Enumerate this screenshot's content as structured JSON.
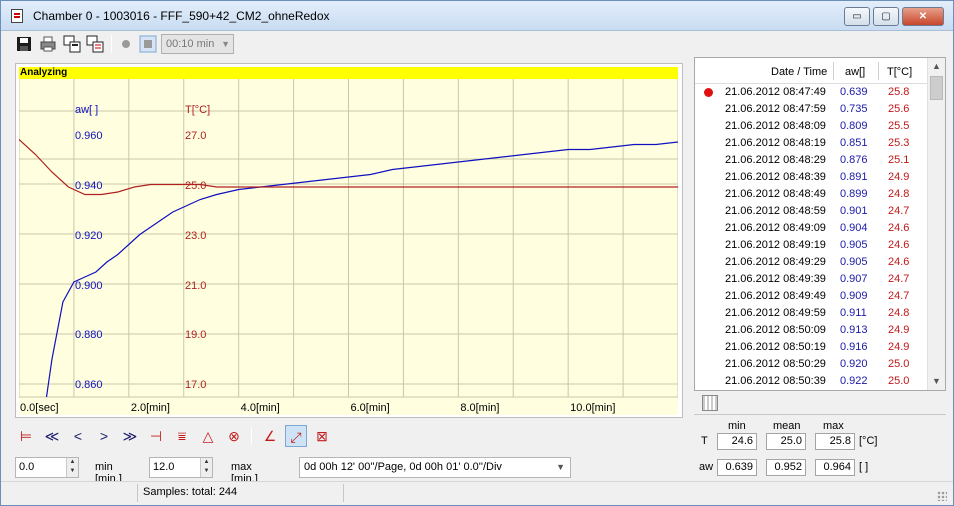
{
  "window": {
    "title": "Chamber 0 - 1003016 - FFF_590+42_CM2_ohneRedox",
    "minimize_glyph": "▭",
    "maximize_glyph": "▢",
    "close_glyph": "✕"
  },
  "toolbar": {
    "interval_value": "00:10 min",
    "icons": [
      "save-icon",
      "print-icon",
      "copy-window-icon",
      "copy-data-icon",
      "record-icon",
      "stop-icon"
    ]
  },
  "chart": {
    "status_label": "Analyzing",
    "status_color": "#ffff00",
    "background_color": "#ffffe0",
    "aw_color": "#1010c0",
    "t_color": "#b02020",
    "aw_axis_label": "aw[ ]",
    "t_axis_label": "T[°C]",
    "aw_ticks": [
      "0.960",
      "0.940",
      "0.920",
      "0.900",
      "0.880",
      "0.860"
    ],
    "t_ticks": [
      "27.0",
      "25.0",
      "23.0",
      "21.0",
      "19.0",
      "17.0"
    ],
    "x_ticks": [
      "0.0[sec]",
      "2.0[min]",
      "4.0[min]",
      "6.0[min]",
      "8.0[min]",
      "10.0[min]"
    ]
  },
  "chart_data": {
    "type": "line",
    "xlim": [
      0,
      12
    ],
    "x_unit": "min",
    "series": [
      {
        "name": "aw[ ]",
        "axis": "left",
        "ylim": [
          0.855,
          0.975
        ],
        "x": [
          0.5,
          0.6,
          0.8,
          1.0,
          1.2,
          1.4,
          1.6,
          1.8,
          2.0,
          2.2,
          2.4,
          2.6,
          2.8,
          3.0,
          3.3,
          3.6,
          4.0,
          4.4,
          4.8,
          5.2,
          5.6,
          6.0,
          6.4,
          6.8,
          7.2,
          7.6,
          8.0,
          8.4,
          8.8,
          9.2,
          9.6,
          10.0,
          10.4,
          10.8,
          11.2,
          11.6,
          12.0
        ],
        "y": [
          0.855,
          0.87,
          0.893,
          0.901,
          0.903,
          0.905,
          0.909,
          0.912,
          0.916,
          0.92,
          0.923,
          0.926,
          0.929,
          0.931,
          0.934,
          0.936,
          0.938,
          0.939,
          0.94,
          0.941,
          0.942,
          0.943,
          0.944,
          0.946,
          0.947,
          0.948,
          0.949,
          0.95,
          0.951,
          0.952,
          0.953,
          0.954,
          0.954,
          0.955,
          0.956,
          0.956,
          0.957
        ]
      },
      {
        "name": "T[°C]",
        "axis": "right",
        "ylim": [
          16.5,
          28.5
        ],
        "x": [
          0.0,
          0.3,
          0.6,
          0.9,
          1.2,
          1.5,
          1.8,
          2.1,
          2.4,
          2.7,
          3.0,
          3.3,
          3.6,
          3.9,
          4.2,
          4.8,
          6.0,
          8.0,
          10.0,
          12.0
        ],
        "y": [
          26.8,
          26.2,
          25.5,
          24.9,
          24.6,
          24.6,
          24.7,
          24.9,
          25.0,
          25.0,
          25.0,
          25.0,
          24.9,
          24.9,
          24.9,
          24.9,
          24.9,
          24.9,
          24.9,
          24.9
        ]
      }
    ]
  },
  "nav": {
    "icons": [
      "first-marker-icon",
      "rewind-icon",
      "previous-icon",
      "next-icon",
      "fast-forward-icon",
      "last-marker-icon",
      "range-icon",
      "baseline-icon",
      "analysis-icon",
      "curve-a-icon",
      "zoom-curve-icon",
      "fit-icon"
    ]
  },
  "range": {
    "min_value": "0.0",
    "min_label": "min [min.]",
    "max_value": "12.0",
    "max_label": "max [min.]",
    "page_setting": "0d 00h 12' 00''/Page, 0d 00h 01' 0.0''/Div"
  },
  "status": {
    "samples": "Samples: total: 244"
  },
  "table": {
    "headers": {
      "date": "Date / Time",
      "aw": "aw[]",
      "t": "T[°C]"
    },
    "rows": [
      {
        "date": "21.06.2012 08:47:49",
        "aw": "0.639",
        "t": "25.8",
        "marker": true
      },
      {
        "date": "21.06.2012 08:47:59",
        "aw": "0.735",
        "t": "25.6"
      },
      {
        "date": "21.06.2012 08:48:09",
        "aw": "0.809",
        "t": "25.5"
      },
      {
        "date": "21.06.2012 08:48:19",
        "aw": "0.851",
        "t": "25.3"
      },
      {
        "date": "21.06.2012 08:48:29",
        "aw": "0.876",
        "t": "25.1"
      },
      {
        "date": "21.06.2012 08:48:39",
        "aw": "0.891",
        "t": "24.9"
      },
      {
        "date": "21.06.2012 08:48:49",
        "aw": "0.899",
        "t": "24.8"
      },
      {
        "date": "21.06.2012 08:48:59",
        "aw": "0.901",
        "t": "24.7"
      },
      {
        "date": "21.06.2012 08:49:09",
        "aw": "0.904",
        "t": "24.6"
      },
      {
        "date": "21.06.2012 08:49:19",
        "aw": "0.905",
        "t": "24.6"
      },
      {
        "date": "21.06.2012 08:49:29",
        "aw": "0.905",
        "t": "24.6"
      },
      {
        "date": "21.06.2012 08:49:39",
        "aw": "0.907",
        "t": "24.7"
      },
      {
        "date": "21.06.2012 08:49:49",
        "aw": "0.909",
        "t": "24.7"
      },
      {
        "date": "21.06.2012 08:49:59",
        "aw": "0.911",
        "t": "24.8"
      },
      {
        "date": "21.06.2012 08:50:09",
        "aw": "0.913",
        "t": "24.9"
      },
      {
        "date": "21.06.2012 08:50:19",
        "aw": "0.916",
        "t": "24.9"
      },
      {
        "date": "21.06.2012 08:50:29",
        "aw": "0.920",
        "t": "25.0"
      },
      {
        "date": "21.06.2012 08:50:39",
        "aw": "0.922",
        "t": "25.0"
      }
    ]
  },
  "stats": {
    "headers": {
      "min": "min",
      "mean": "mean",
      "max": "max"
    },
    "t_label": "T",
    "t_min": "24.6",
    "t_mean": "25.0",
    "t_max": "25.8",
    "t_unit": "[°C]",
    "aw_label": "aw",
    "aw_min": "0.639",
    "aw_mean": "0.952",
    "aw_max": "0.964",
    "aw_unit": "[ ]"
  }
}
